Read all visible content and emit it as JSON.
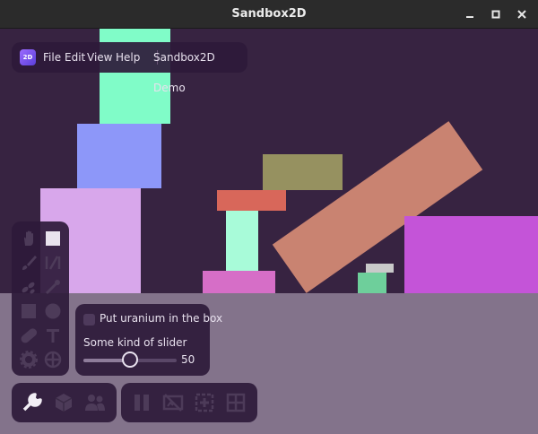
{
  "window": {
    "title": "Sandbox2D"
  },
  "menu": {
    "logo_text": "2D",
    "items": [
      "File",
      "Edit",
      "View",
      "Help"
    ],
    "demo_label": "Sandbox2D Demo"
  },
  "options": {
    "checkbox_label": "Put uranium in the box",
    "checkbox_checked": false,
    "slider_label": "Some kind of slider",
    "slider_value": "50",
    "slider_fraction": 0.5
  },
  "scene": {
    "background": "#372341",
    "ground": "#83738b",
    "bodies": [
      {
        "name": "tower-top-box",
        "color": "#80fcc8"
      },
      {
        "name": "tower-middle-box",
        "color": "#8d97f9"
      },
      {
        "name": "tower-base-box",
        "color": "#d8a7eb"
      },
      {
        "name": "olive-plank",
        "color": "#969160"
      },
      {
        "name": "red-plank",
        "color": "#d8675a"
      },
      {
        "name": "mint-pillar",
        "color": "#a8fbd9"
      },
      {
        "name": "pink-base",
        "color": "#d66ec7"
      },
      {
        "name": "tilted-plank",
        "color": "#c98371"
      },
      {
        "name": "grey-block",
        "color": "#c9c9c9"
      },
      {
        "name": "green-block",
        "color": "#6ecf9b"
      },
      {
        "name": "magenta-box",
        "color": "#c454d8"
      }
    ]
  },
  "tools": [
    "hand-icon",
    "select-square-icon",
    "brush-icon",
    "joint-icon",
    "scatter-icon",
    "wand-icon",
    "rectangle-icon",
    "circle-icon",
    "capsule-icon",
    "text-icon",
    "gear-icon",
    "target-icon"
  ],
  "mode_buttons": [
    "wrench-icon",
    "cube-icon",
    "people-icon"
  ],
  "sim_buttons": [
    "pause-icon",
    "no-display-icon",
    "add-frame-icon",
    "grid-icon"
  ]
}
